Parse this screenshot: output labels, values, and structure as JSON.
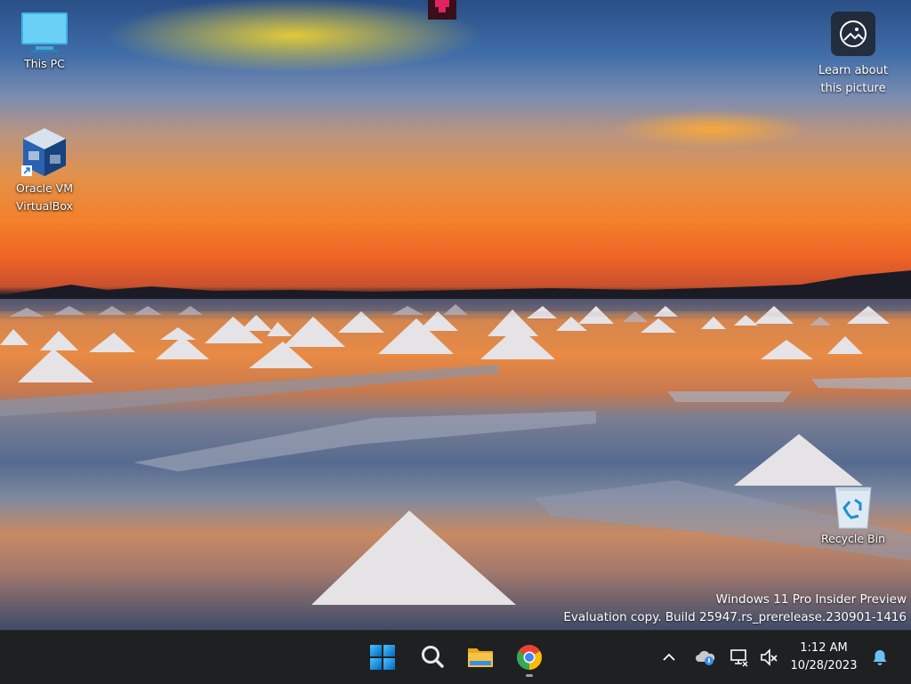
{
  "desktop": {
    "icons": [
      {
        "label": "This PC",
        "icon": "this-pc-icon"
      },
      {
        "label_line1": "Oracle VM",
        "label_line2": "VirtualBox",
        "icon": "virtualbox-icon"
      },
      {
        "label": "Recycle Bin",
        "icon": "recycle-bin-icon"
      }
    ],
    "spotlight": {
      "label_line1": "Learn about",
      "label_line2": "this picture",
      "icon": "image-info-icon"
    },
    "watermark": {
      "line1": "Windows 11 Pro Insider Preview",
      "line2": "Evaluation copy. Build 25947.rs_prerelease.230901-1416"
    }
  },
  "taskbar": {
    "pinned": [
      {
        "name": "start",
        "icon": "windows-logo-icon"
      },
      {
        "name": "search",
        "icon": "search-icon"
      },
      {
        "name": "file-explorer",
        "icon": "folder-icon"
      },
      {
        "name": "chrome",
        "icon": "chrome-icon"
      }
    ],
    "tray": {
      "overflow_icon": "chevron-up-icon",
      "onedrive_icon": "cloud-icon",
      "network_icon": "network-icon",
      "volume_icon": "volume-muted-icon",
      "notifications_icon": "bell-icon"
    },
    "clock": {
      "time": "1:12 AM",
      "date": "10/28/2023"
    }
  },
  "colors": {
    "taskbar_bg": "#1f2021",
    "windows_blue": "#0078d4",
    "folder_yellow": "#f4c242",
    "chrome_red": "#ea4335",
    "chrome_green": "#34a853",
    "chrome_yellow": "#fbbc05",
    "chrome_blue": "#4285f4"
  }
}
